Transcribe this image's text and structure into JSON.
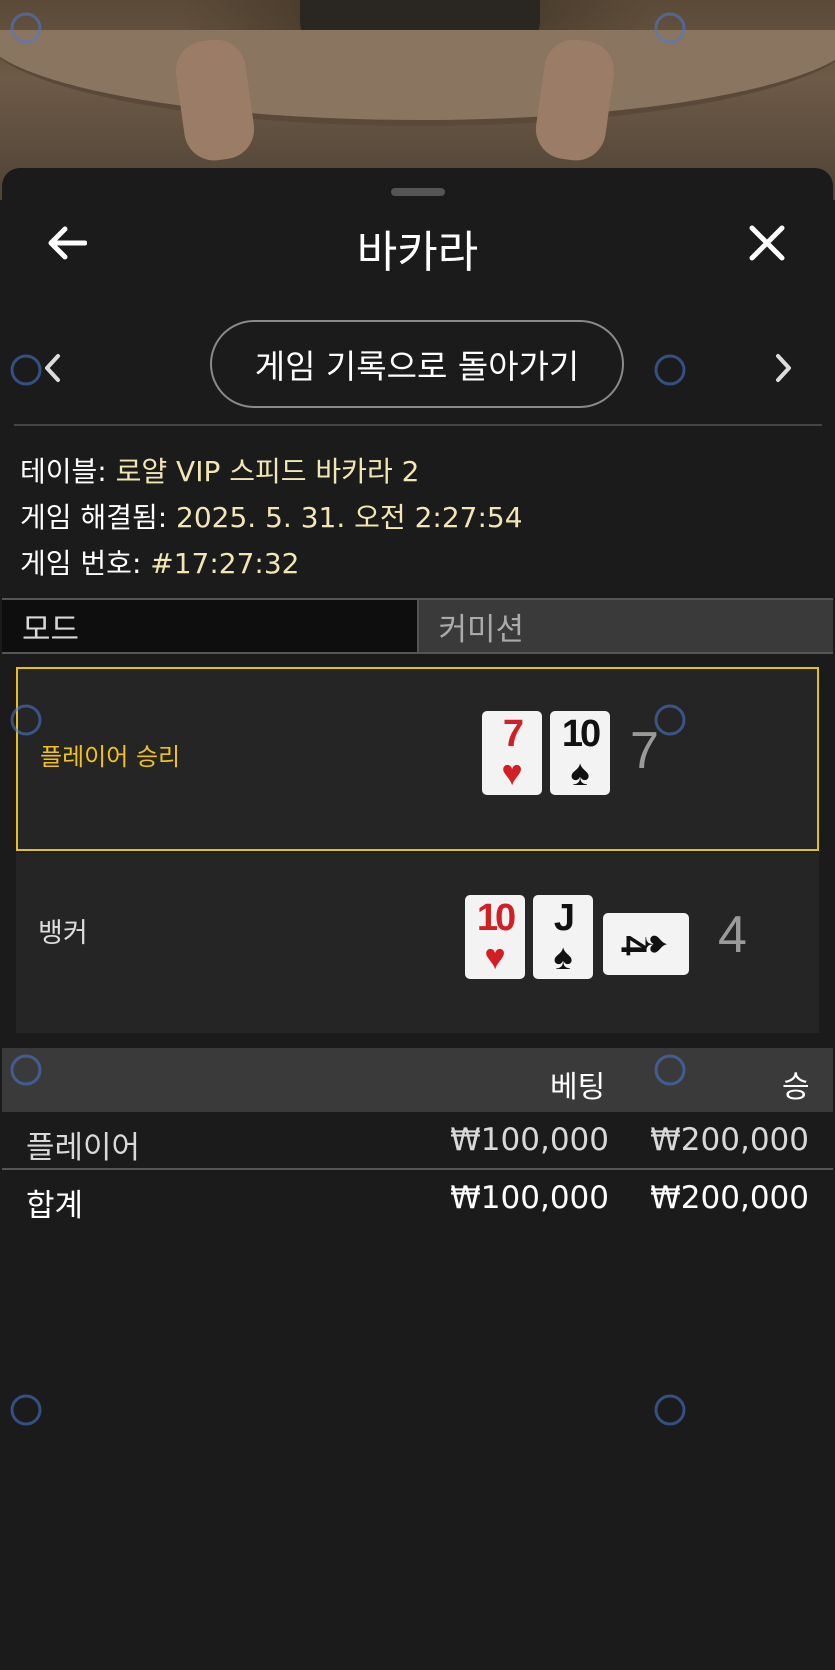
{
  "header": {
    "title": "바카라",
    "back_icon": "arrow-left-icon",
    "close_icon": "close-icon"
  },
  "navigation": {
    "back_to_history_label": "게임 기록으로 돌아가기",
    "prev_icon": "chevron-left-icon",
    "next_icon": "chevron-right-icon"
  },
  "info": {
    "table_label": "테이블: ",
    "table_value": "로얄 VIP 스피드 바카라 2",
    "resolved_label": "게임 해결됨: ",
    "resolved_value": "2025. 5. 31. 오전 2:27:54",
    "game_no_label": "게임 번호: ",
    "game_no_value": "#17:27:32"
  },
  "tabs": [
    {
      "label": "모드",
      "active": true
    },
    {
      "label": "커미션",
      "active": false
    }
  ],
  "result": {
    "player": {
      "label": "플레이어 승리",
      "score": "7",
      "cards": [
        {
          "rank": "7",
          "suit": "♥",
          "color": "red"
        },
        {
          "rank": "10",
          "suit": "♠",
          "color": "black"
        }
      ]
    },
    "banker": {
      "label": "뱅커",
      "score": "4",
      "cards": [
        {
          "rank": "10",
          "suit": "♥",
          "color": "red"
        },
        {
          "rank": "J",
          "suit": "♠",
          "color": "black"
        },
        {
          "rank": "4",
          "suit": "♠",
          "color": "black",
          "sideways": true
        }
      ]
    }
  },
  "bets": {
    "col_bet": "베팅",
    "col_win": "승",
    "rows": [
      {
        "name": "플레이어",
        "bet": "₩100,000",
        "win": "₩200,000"
      }
    ],
    "total": {
      "name": "합계",
      "bet": "₩100,000",
      "win": "₩200,000"
    }
  },
  "colors": {
    "accent_gold": "#e3c118",
    "info_value": "#f3e6b5",
    "card_red": "#d31f24"
  }
}
